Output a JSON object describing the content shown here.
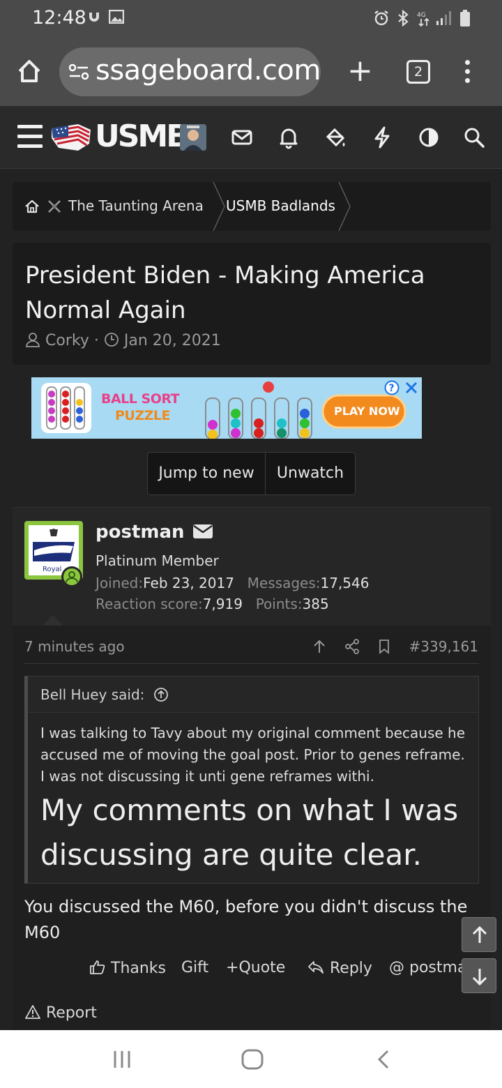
{
  "status_bar": {
    "time": "12:48",
    "icons": [
      "notification-icon",
      "gallery-icon",
      "alarm-icon",
      "bluetooth-icon",
      "data-icon",
      "signal-icon",
      "battery-icon"
    ]
  },
  "browser": {
    "url": "ssageboard.com",
    "tab_count": "2"
  },
  "site": {
    "logo": "USMB"
  },
  "breadcrumb": {
    "items": [
      "The Taunting Arena",
      "USMB Badlands"
    ]
  },
  "thread": {
    "title": "President Biden - Making America Normal Again",
    "author": "Corky",
    "date": "Jan 20, 2021"
  },
  "ad": {
    "title_line1": "BALL SORT",
    "title_line2": "PUZZLE",
    "cta": "PLAY NOW"
  },
  "thread_buttons": {
    "jump": "Jump to new",
    "unwatch": "Unwatch"
  },
  "post": {
    "username": "postman",
    "user_title": "Platinum Member",
    "avatar_text": "Royal",
    "joined_label": "Joined:",
    "joined": "Feb 23, 2017",
    "messages_label": "Messages:",
    "messages": "17,546",
    "reaction_label": "Reaction score:",
    "reaction": "7,919",
    "points_label": "Points:",
    "points": "385",
    "time": "7 minutes ago",
    "number": "#339,161",
    "quote": {
      "author": "Bell Huey said:",
      "text": "I was talking to Tavy about my original comment because he accused me of moving the goal post. Prior to genes reframe. I was not discussing it unti gene reframes withi.",
      "big_text": "My comments on what I was discussing are quite clear."
    },
    "body": "You discussed the M60, before you didn't discuss the M60",
    "actions": {
      "thanks": "Thanks",
      "gift": "Gift",
      "quote": "Quote",
      "reply": "Reply",
      "mention": "postman",
      "report": "Report"
    }
  },
  "colors": {
    "background": "#222222",
    "avatar_border": "#8cc63f",
    "nav_bar": "#ffffff"
  }
}
